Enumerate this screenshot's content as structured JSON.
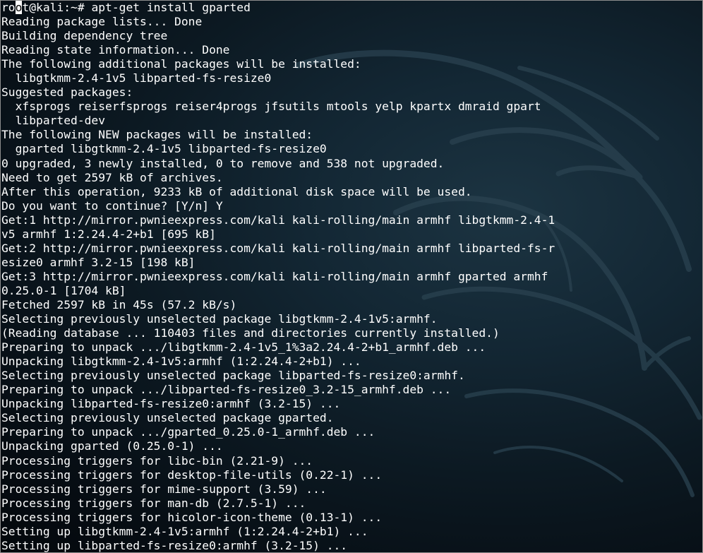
{
  "prompt": {
    "before_cursor": "ro",
    "cursor_char": "o",
    "after_cursor": "t@kali:~# apt-get install gparted"
  },
  "output_lines": [
    "Reading package lists... Done",
    "Building dependency tree",
    "Reading state information... Done",
    "The following additional packages will be installed:",
    "  libgtkmm-2.4-1v5 libparted-fs-resize0",
    "Suggested packages:",
    "  xfsprogs reiserfsprogs reiser4progs jfsutils mtools yelp kpartx dmraid gpart",
    "  libparted-dev",
    "The following NEW packages will be installed:",
    "  gparted libgtkmm-2.4-1v5 libparted-fs-resize0",
    "0 upgraded, 3 newly installed, 0 to remove and 538 not upgraded.",
    "Need to get 2597 kB of archives.",
    "After this operation, 9233 kB of additional disk space will be used.",
    "Do you want to continue? [Y/n] Y",
    "Get:1 http://mirror.pwnieexpress.com/kali kali-rolling/main armhf libgtkmm-2.4-1",
    "v5 armhf 1:2.24.4-2+b1 [695 kB]",
    "Get:2 http://mirror.pwnieexpress.com/kali kali-rolling/main armhf libparted-fs-r",
    "esize0 armhf 3.2-15 [198 kB]",
    "Get:3 http://mirror.pwnieexpress.com/kali kali-rolling/main armhf gparted armhf",
    "0.25.0-1 [1704 kB]",
    "Fetched 2597 kB in 45s (57.2 kB/s)",
    "Selecting previously unselected package libgtkmm-2.4-1v5:armhf.",
    "(Reading database ... 110403 files and directories currently installed.)",
    "Preparing to unpack .../libgtkmm-2.4-1v5_1%3a2.24.4-2+b1_armhf.deb ...",
    "Unpacking libgtkmm-2.4-1v5:armhf (1:2.24.4-2+b1) ...",
    "Selecting previously unselected package libparted-fs-resize0:armhf.",
    "Preparing to unpack .../libparted-fs-resize0_3.2-15_armhf.deb ...",
    "Unpacking libparted-fs-resize0:armhf (3.2-15) ...",
    "Selecting previously unselected package gparted.",
    "Preparing to unpack .../gparted_0.25.0-1_armhf.deb ...",
    "Unpacking gparted (0.25.0-1) ...",
    "Processing triggers for libc-bin (2.21-9) ...",
    "Processing triggers for desktop-file-utils (0.22-1) ...",
    "Processing triggers for mime-support (3.59) ...",
    "Processing triggers for man-db (2.7.5-1) ...",
    "Processing triggers for hicolor-icon-theme (0.13-1) ...",
    "Setting up libgtkmm-2.4-1v5:armhf (1:2.24.4-2+b1) ...",
    "Setting up libparted-fs-resize0:armhf (3.2-15) ..."
  ],
  "colors": {
    "text": "#ffffff",
    "background": "#0c1922",
    "watermark": "#2a4250"
  },
  "background_icon": "kali-dragon-watermark"
}
